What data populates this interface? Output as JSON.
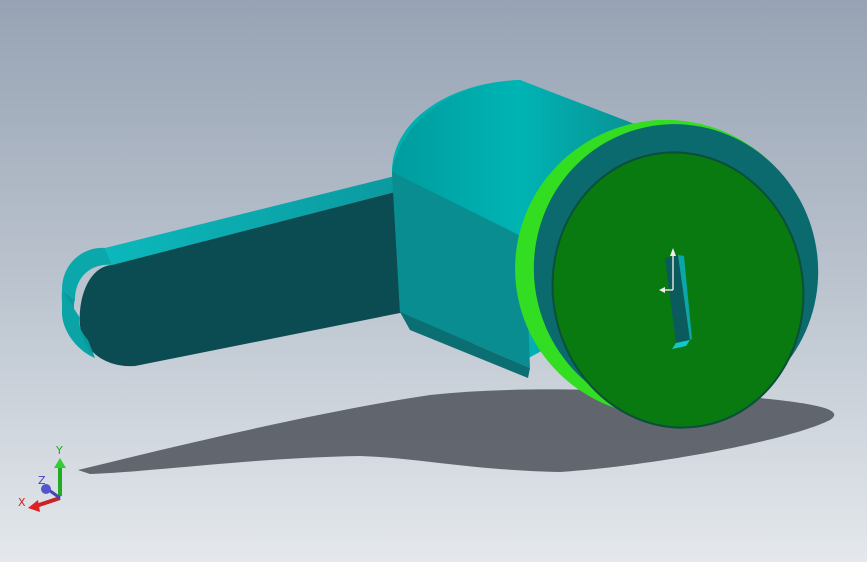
{
  "viewport": {
    "background_top": "#97a3b4",
    "background_bottom": "#e4e8ec"
  },
  "part": {
    "body_color": "#00aaaa",
    "body_dark": "#0d5f63",
    "arm_color": "#0b4c52",
    "ring_color": "#33dd22",
    "face_color": "#0a7f10"
  },
  "triad": {
    "x_label": "X",
    "y_label": "Y",
    "z_label": "Z",
    "x_color": "#cc2222",
    "y_color": "#22aa22",
    "z_color": "#4444bb"
  }
}
